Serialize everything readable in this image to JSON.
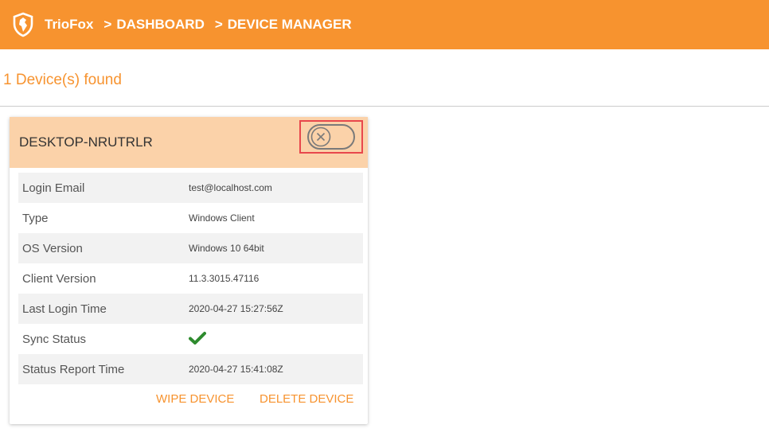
{
  "header": {
    "brand": "TrioFox",
    "breadcrumb": [
      {
        "sep": ">",
        "label": "DASHBOARD"
      },
      {
        "sep": ">",
        "label": "DEVICE MANAGER"
      }
    ]
  },
  "main": {
    "found_text": "1 Device(s) found"
  },
  "device": {
    "name": "DESKTOP-NRUTRLR",
    "toggle_state": "off",
    "rows": [
      {
        "label": "Login Email",
        "value": "test@localhost.com"
      },
      {
        "label": "Type",
        "value": "Windows Client"
      },
      {
        "label": "OS Version",
        "value": "Windows 10 64bit"
      },
      {
        "label": "Client Version",
        "value": "11.3.3015.47116"
      },
      {
        "label": "Last Login Time",
        "value": "2020-04-27 15:27:56Z"
      },
      {
        "label": "Sync Status",
        "icon": "check-icon"
      },
      {
        "label": "Status Report Time",
        "value": "2020-04-27 15:41:08Z"
      }
    ],
    "actions": {
      "wipe": "WIPE DEVICE",
      "delete": "DELETE DEVICE"
    }
  },
  "colors": {
    "accent": "#f7932f",
    "card_header": "#fbd2a9",
    "highlight_frame": "#e8474c",
    "check": "#2e8b2e"
  }
}
